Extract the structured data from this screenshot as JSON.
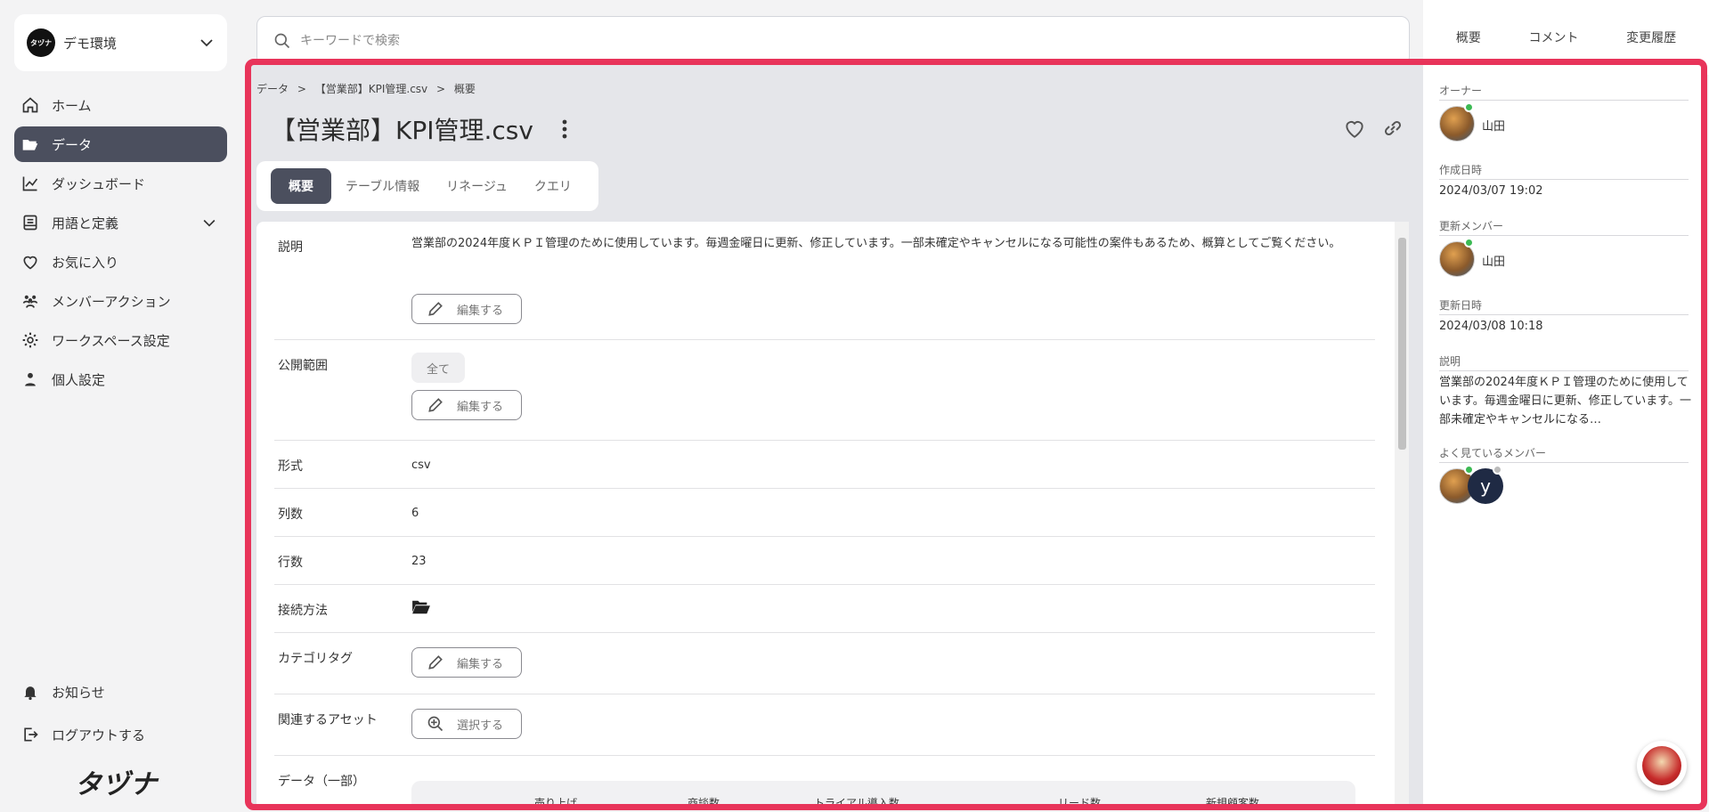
{
  "workspace": {
    "name": "デモ環境",
    "logo_text": "タヅナ"
  },
  "nav": [
    {
      "label": "ホーム",
      "icon": "home-icon"
    },
    {
      "label": "データ",
      "icon": "folder-open-icon",
      "active": true
    },
    {
      "label": "ダッシュボード",
      "icon": "chart-line-icon"
    },
    {
      "label": "用語と定義",
      "icon": "book-icon"
    },
    {
      "label": "お気に入り",
      "icon": "heart-icon"
    },
    {
      "label": "メンバーアクション",
      "icon": "users-icon"
    },
    {
      "label": "ワークスペース設定",
      "icon": "gear-icon"
    },
    {
      "label": "個人設定",
      "icon": "person-icon"
    }
  ],
  "nav_bottom": [
    {
      "label": "お知らせ",
      "icon": "bell-icon"
    },
    {
      "label": "ログアウトする",
      "icon": "logout-icon"
    }
  ],
  "brand": "タヅナ",
  "search": {
    "placeholder": "キーワードで検索"
  },
  "right_tabs": [
    "概要",
    "コメント",
    "変更履歴"
  ],
  "breadcrumb": [
    "データ",
    ">",
    "【営業部】KPI管理.csv",
    ">",
    "概要"
  ],
  "page_title": "【営業部】KPI管理.csv",
  "tabs": [
    "概要",
    "テーブル情報",
    "リネージュ",
    "クエリ"
  ],
  "detail": {
    "description_label": "説明",
    "description": "営業部の2024年度ＫＰＩ管理のために使用しています。毎週金曜日に更新、修正しています。一部未確定やキャンセルになる可能性の案件もあるため、概算としてご覧ください。",
    "edit_label": "編集する",
    "scope_label": "公開範囲",
    "scope_value": "全て",
    "format_label": "形式",
    "format_value": "csv",
    "columns_label": "列数",
    "columns_value": "6",
    "rows_label": "行数",
    "rows_value": "23",
    "connection_label": "接続方法",
    "category_label": "カテゴリタグ",
    "assets_label": "関連するアセット",
    "select_label": "選択する",
    "data_label": "データ（一部）",
    "table_headers": [
      "売り上げ",
      "商談数",
      "トライアル導入数",
      "リード数",
      "新規顧客数"
    ]
  },
  "sidepanel": {
    "owner_label": "オーナー",
    "owner_name": "山田",
    "created_label": "作成日時",
    "created_value": "2024/03/07 19:02",
    "updater_label": "更新メンバー",
    "updater_name": "山田",
    "updated_label": "更新日時",
    "updated_value": "2024/03/08 10:18",
    "description_label": "説明",
    "description": "営業部の2024年度ＫＰＩ管理のために使用しています。毎週金曜日に更新、修正しています。一部未確定やキャンセルになる…",
    "viewers_label": "よく見ているメンバー",
    "viewer_initial": "y"
  }
}
